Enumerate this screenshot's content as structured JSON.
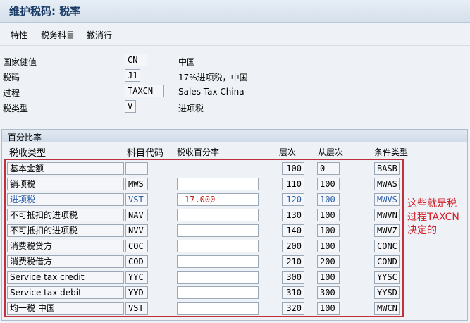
{
  "window": {
    "title": "维护税码: 税率"
  },
  "toolbar": {
    "items": [
      "特性",
      "税务科目",
      "撤消行"
    ]
  },
  "header": {
    "country": {
      "label": "国家健值",
      "value": "CN",
      "desc": "中国"
    },
    "tax_code": {
      "label": "税码",
      "value": "J1",
      "desc": "17%进项税，中国"
    },
    "procedure": {
      "label": "过程",
      "value": "TAXCN",
      "desc": "Sales Tax China"
    },
    "tax_type": {
      "label": "税类型",
      "value": "V",
      "desc": "进项税"
    }
  },
  "rates_panel": {
    "title": "百分比率",
    "columns": {
      "name": "税收类型",
      "acct": "科目代码",
      "rate": "税收百分率",
      "level": "层次",
      "from": "从层次",
      "cond": "条件类型"
    },
    "rows": [
      {
        "name": "基本金额",
        "acct": "",
        "rate": null,
        "level": "100",
        "from": "0",
        "cond": "BASB"
      },
      {
        "name": "销项税",
        "acct": "MWS",
        "rate": "",
        "level": "110",
        "from": "100",
        "cond": "MWAS"
      },
      {
        "name": "进项税",
        "acct": "VST",
        "rate": "17.000",
        "level": "120",
        "from": "100",
        "cond": "MWVS"
      },
      {
        "name": "不可抵扣的进项税",
        "acct": "NAV",
        "rate": "",
        "level": "130",
        "from": "100",
        "cond": "MWVN"
      },
      {
        "name": "不可抵扣的进项税",
        "acct": "NVV",
        "rate": "",
        "level": "140",
        "from": "100",
        "cond": "MWVZ"
      },
      {
        "name": "消费税贷方",
        "acct": "COC",
        "rate": "",
        "level": "200",
        "from": "100",
        "cond": "CONC"
      },
      {
        "name": "消费税借方",
        "acct": "COD",
        "rate": "",
        "level": "210",
        "from": "200",
        "cond": "COND"
      },
      {
        "name": "Service tax credit",
        "acct": "YYC",
        "rate": "",
        "level": "300",
        "from": "100",
        "cond": "YYSC"
      },
      {
        "name": "Service tax debit",
        "acct": "YYD",
        "rate": "",
        "level": "310",
        "from": "300",
        "cond": "YYSD"
      },
      {
        "name": "均一税 中国",
        "acct": "VST",
        "rate": "",
        "level": "320",
        "from": "100",
        "cond": "MWCN"
      }
    ],
    "highlight_row": 2
  },
  "annotation": {
    "lines": [
      "这些就是税",
      "过程TAXCN",
      "决定的"
    ],
    "color": "#d3202a"
  }
}
